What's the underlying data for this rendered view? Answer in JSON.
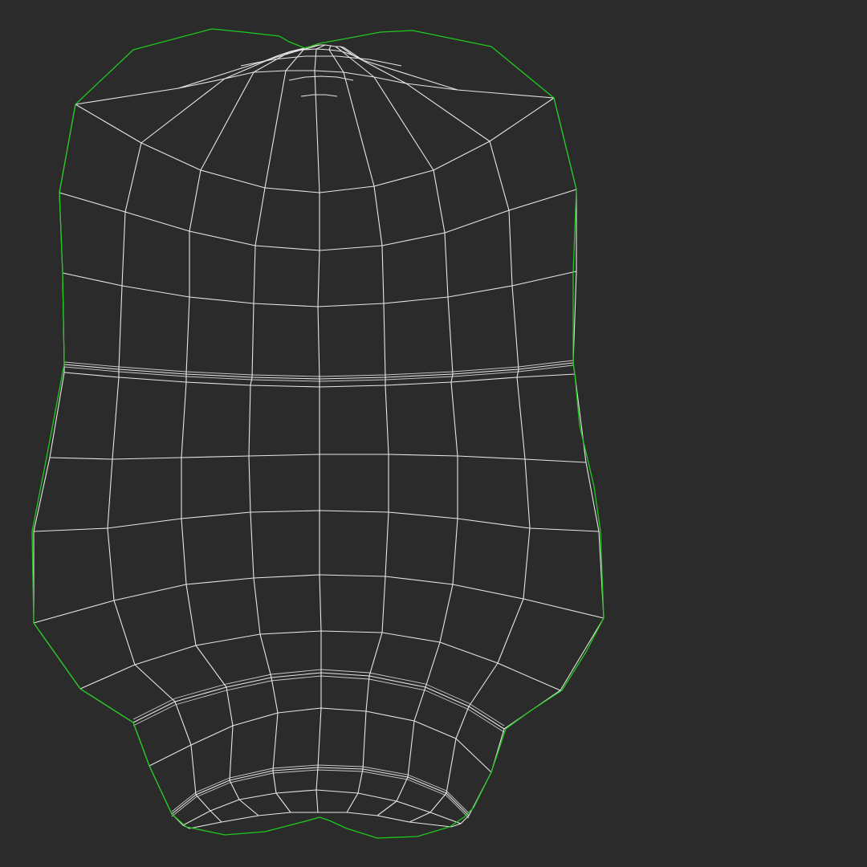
{
  "viewport": {
    "background_color": "#2b2b2b",
    "wire_color": "#e6e6e6",
    "seam_color": "#20c81e"
  },
  "uv_shell": {
    "rows": 17,
    "cols": 8,
    "seam_bands": 3,
    "has_top_notch": true,
    "has_bottom_notch": true
  }
}
